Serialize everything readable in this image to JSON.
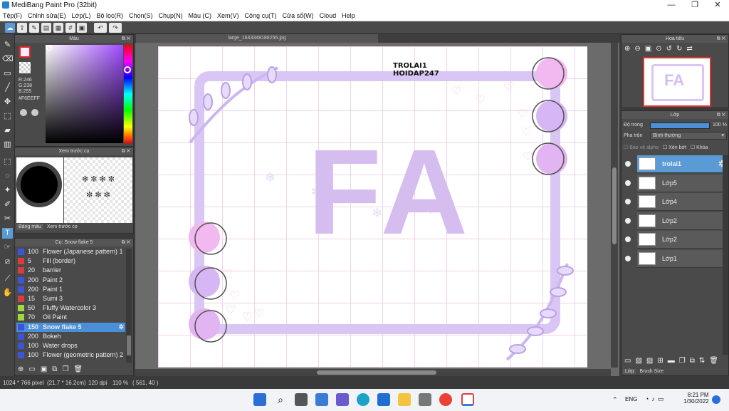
{
  "window": {
    "title": "MediBang Paint Pro (32bit)",
    "min": "—",
    "max": "❐",
    "close": "✕"
  },
  "menu": [
    "Tệp(F)",
    "Chỉnh sửa(E)",
    "Lớp(L)",
    "Bộ lọc(R)",
    "Chọn(S)",
    "Chụp(N)",
    "Màu (C)",
    "Xem(V)",
    "Công cụ(T)",
    "Cửa sổ(W)",
    "Cloud",
    "Help"
  ],
  "panels": {
    "color": "Màu",
    "brush_preview": "Xem trước cọ",
    "tabs": [
      "Bảng màu",
      "Xem trước cọ"
    ],
    "brush_title": "Cọ: Snow flake 5",
    "navigator": "Hoa tiêu",
    "layers": "Lớp"
  },
  "color": {
    "r": "R:246",
    "g": "G:238",
    "b": "B:255",
    "hex": "#F6EEFF",
    "fg": "#F6EEFF"
  },
  "brushes": [
    {
      "size": "100",
      "name": "Flower (Japanese pattern) 1",
      "color": "#3c55d8"
    },
    {
      "size": "5",
      "name": "Fill (border)",
      "color": "#d83c3c"
    },
    {
      "size": "20",
      "name": "barrier",
      "color": "#d83c3c"
    },
    {
      "size": "200",
      "name": "Paint 2",
      "color": "#3c55d8"
    },
    {
      "size": "200",
      "name": "Paint 1",
      "color": "#3c55d8"
    },
    {
      "size": "15",
      "name": "Sumi 3",
      "color": "#d83c3c"
    },
    {
      "size": "50",
      "name": "Fluffy Watercolor 3",
      "color": "#9ed83c"
    },
    {
      "size": "70",
      "name": "Oil Paint",
      "color": "#9ed83c"
    },
    {
      "size": "150",
      "name": "Snow flake 5",
      "color": "#3c55d8",
      "selected": true
    },
    {
      "size": "200",
      "name": "Bokeh",
      "color": "#3c55d8"
    },
    {
      "size": "100",
      "name": "Water drops",
      "color": "#3c55d8"
    },
    {
      "size": "100",
      "name": "Flower (geometric pattern) 2",
      "color": "#3c55d8"
    }
  ],
  "document": {
    "tab": "large_1643348188256.jpg",
    "watermark1": "TROLAI1",
    "watermark2": "HOIDAP247",
    "letters": "FA"
  },
  "layers": {
    "opacity_label": "Độ trong",
    "opacity_value": "100 %",
    "blend_label": "Pha trộn",
    "blend_value": "Bình thường",
    "alpha_protect": "Bảo vệ alpha",
    "clip": "Xén bớt",
    "lock": "Khóa",
    "items": [
      {
        "name": "trolai1",
        "selected": true
      },
      {
        "name": "Lớp5"
      },
      {
        "name": "Lớp4"
      },
      {
        "name": "Lớp2"
      },
      {
        "name": "Lớp2"
      },
      {
        "name": "Lớp1"
      }
    ],
    "bottom_tabs": [
      "Lớp",
      "Brush Size"
    ]
  },
  "status": {
    "size": "1024 * 766 pixel",
    "cm": "(21.7 * 16.2cm)",
    "dpi": "120 dpi",
    "zoom": "110 %",
    "coords": "( 561, 40 )"
  },
  "taskbar": {
    "lang": "ENG",
    "time": "8:21 PM",
    "date": "1/30/2022"
  },
  "colors": {
    "accent": "#4a90d9",
    "selected_layer": "#5b9bd5",
    "frame": "#d9c6f5",
    "letters": "#d6bdf0"
  }
}
